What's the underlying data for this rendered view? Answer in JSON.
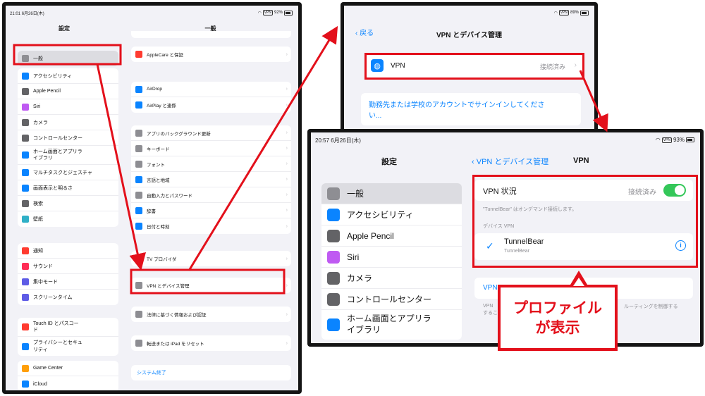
{
  "screen1": {
    "status_time": "21:01",
    "status_date": "6月26日(木)",
    "status_vpn": "VPN",
    "status_battery": "92%",
    "sidebar_title": "設定",
    "detail_title": "一般",
    "sidebar_groups": [
      [
        {
          "label": "一般",
          "icon": "gear-icon",
          "color": "#8e8e93",
          "selected": true
        }
      ],
      [
        {
          "label": "アクセシビリティ",
          "icon": "accessibility-icon",
          "color": "#0a84ff"
        },
        {
          "label": "Apple Pencil",
          "icon": "pencil-icon",
          "color": "#636366"
        },
        {
          "label": "Siri",
          "icon": "siri-icon",
          "color": "#bf5af2"
        },
        {
          "label": "カメラ",
          "icon": "camera-icon",
          "color": "#636366"
        },
        {
          "label": "コントロールセンター",
          "icon": "control-center-icon",
          "color": "#636366"
        },
        {
          "label": "ホーム画面とアプリライブラリ",
          "icon": "home-screen-icon",
          "color": "#0a84ff"
        },
        {
          "label": "マルチタスクとジェスチャ",
          "icon": "multitask-icon",
          "color": "#0a84ff"
        },
        {
          "label": "画面表示と明るさ",
          "icon": "brightness-icon",
          "color": "#0a84ff"
        },
        {
          "label": "検索",
          "icon": "search-icon",
          "color": "#636366"
        },
        {
          "label": "壁紙",
          "icon": "wallpaper-icon",
          "color": "#30b0c7"
        }
      ],
      [
        {
          "label": "通知",
          "icon": "bell-icon",
          "color": "#ff3b30"
        },
        {
          "label": "サウンド",
          "icon": "speaker-icon",
          "color": "#ff2d55"
        },
        {
          "label": "集中モード",
          "icon": "moon-icon",
          "color": "#5e5ce6"
        },
        {
          "label": "スクリーンタイム",
          "icon": "hourglass-icon",
          "color": "#5e5ce6"
        }
      ],
      [
        {
          "label": "Touch ID とパスコード",
          "icon": "fingerprint-icon",
          "color": "#ff3b30"
        },
        {
          "label": "プライバシーとセキュリティ",
          "icon": "hand-icon",
          "color": "#0a84ff"
        }
      ],
      [
        {
          "label": "Game Center",
          "icon": "game-center-icon",
          "color": "#ff9f0a"
        },
        {
          "label": "iCloud",
          "icon": "cloud-icon",
          "color": "#0a84ff"
        }
      ]
    ],
    "detail_groups": [
      [
        {
          "label": "AppleCare と保証",
          "icon": "apple-icon",
          "color": "#ff3b30"
        }
      ],
      [
        {
          "label": "AirDrop",
          "icon": "airdrop-icon",
          "color": "#0a84ff"
        },
        {
          "label": "AirPlay と連係",
          "icon": "airplay-icon",
          "color": "#0a84ff"
        }
      ],
      [
        {
          "label": "アプリのバックグラウンド更新",
          "icon": "refresh-icon",
          "color": "#8e8e93"
        },
        {
          "label": "キーボード",
          "icon": "keyboard-icon",
          "color": "#8e8e93"
        },
        {
          "label": "フォント",
          "icon": "font-icon",
          "color": "#8e8e93"
        },
        {
          "label": "言語と地域",
          "icon": "globe-icon",
          "color": "#0a84ff"
        },
        {
          "label": "自動入力とパスワード",
          "icon": "key-icon",
          "color": "#8e8e93"
        },
        {
          "label": "辞書",
          "icon": "dictionary-icon",
          "color": "#0a84ff"
        },
        {
          "label": "日付と時刻",
          "icon": "calendar-icon",
          "color": "#0a84ff"
        }
      ],
      [
        {
          "label": "TV プロバイダ",
          "icon": "tv-icon",
          "color": "#1c1c1e"
        }
      ],
      [
        {
          "label": "VPN とデバイス管理",
          "icon": "gear-icon",
          "color": "#8e8e93"
        }
      ],
      [
        {
          "label": "法律に基づく情報および認証",
          "icon": "document-icon",
          "color": "#8e8e93"
        }
      ],
      [
        {
          "label": "転送または iPad をリセット",
          "icon": "reset-icon",
          "color": "#8e8e93"
        }
      ]
    ],
    "shutdown_label": "システム終了"
  },
  "screen2": {
    "status_vpn": "VPN",
    "status_battery": "89%",
    "back_label": "戻る",
    "title": "VPN とデバイス管理",
    "vpn_label": "VPN",
    "vpn_status": "接続済み",
    "signin_text": "勤務先または学校のアカウントでサインインしてください..."
  },
  "screen3": {
    "status_time": "20:57",
    "status_date": "6月26日(木)",
    "status_vpn": "VPN",
    "status_battery": "93%",
    "sidebar_title": "設定",
    "back_label": "VPN とデバイス管理",
    "title": "VPN",
    "sidebar_items": [
      {
        "label": "一般",
        "icon": "gear-icon",
        "color": "#8e8e93",
        "selected": true
      },
      {
        "label": "アクセシビリティ",
        "icon": "accessibility-icon",
        "color": "#0a84ff"
      },
      {
        "label": "Apple Pencil",
        "icon": "pencil-icon",
        "color": "#636366"
      },
      {
        "label": "Siri",
        "icon": "siri-icon",
        "color": "#bf5af2"
      },
      {
        "label": "カメラ",
        "icon": "camera-icon",
        "color": "#636366"
      },
      {
        "label": "コントロールセンター",
        "icon": "control-center-icon",
        "color": "#636366"
      },
      {
        "label": "ホーム画面とアプリライブラリ",
        "icon": "home-screen-icon",
        "color": "#0a84ff"
      }
    ],
    "vpn_status_label": "VPN 状況",
    "vpn_status_value": "接続済み",
    "on_demand_note": "\"TunnelBear\" はオンデマンド接続します。",
    "device_vpn_header": "デバイス VPN",
    "profile_name": "TunnelBear",
    "profile_sub": "TunnelBear",
    "partial_row_label": "VPN",
    "partial_note_left": "VPN",
    "partial_note_right": "ルーティングを制御する",
    "partial_note_left2": "するこ"
  },
  "callout": {
    "line1": "プロファイル",
    "line2": "が表示"
  },
  "colors": {
    "highlight_red": "#e3101b",
    "ios_blue": "#0a84ff",
    "toggle_green": "#34c759"
  }
}
